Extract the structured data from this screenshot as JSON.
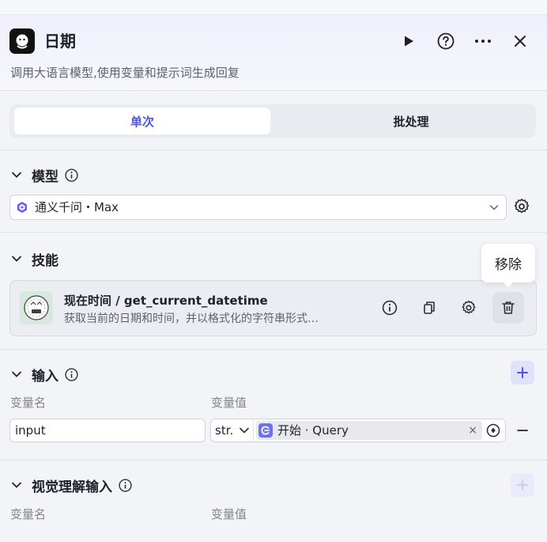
{
  "header": {
    "title": "日期",
    "description": "调用大语言模型,使用变量和提示词生成回复"
  },
  "tabs": {
    "single": "单次",
    "batch": "批处理"
  },
  "model_section": {
    "title": "模型",
    "selected_model": "通义千问・Max"
  },
  "skills_section": {
    "title": "技能",
    "tooltip": "移除",
    "skill": {
      "name": "现在时间 / get_current_datetime",
      "description": "获取当前的日期和时间，并以格式化的字符串形式…"
    }
  },
  "input_section": {
    "title": "输入",
    "col_name": "变量名",
    "col_value": "变量值",
    "row": {
      "name_value": "input",
      "type": "str.",
      "ref_label": "开始 · Query",
      "clear_glyph": "×"
    }
  },
  "vision_section": {
    "title": "视觉理解输入",
    "col_name": "变量名",
    "col_value": "变量值"
  },
  "colors": {
    "accent": "#4d53e8",
    "icon": "#2b2f36",
    "muted": "#80858f"
  }
}
